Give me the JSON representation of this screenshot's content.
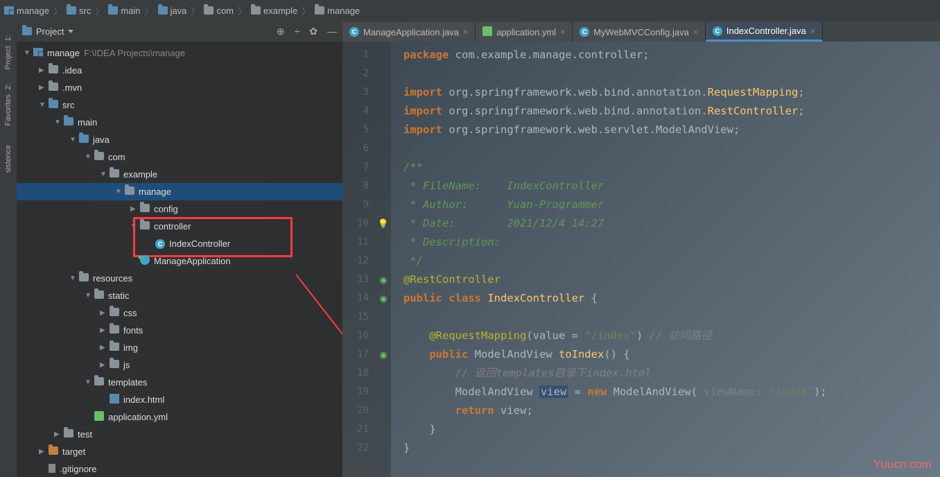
{
  "breadcrumbs": [
    {
      "icon": "module",
      "label": "manage"
    },
    {
      "icon": "folder-blue",
      "label": "src"
    },
    {
      "icon": "folder-blue",
      "label": "main"
    },
    {
      "icon": "folder-blue",
      "label": "java"
    },
    {
      "icon": "folder",
      "label": "com"
    },
    {
      "icon": "folder",
      "label": "example"
    },
    {
      "icon": "folder",
      "label": "manage"
    }
  ],
  "project": {
    "title": "Project",
    "root": {
      "name": "manage",
      "path": "F:\\IDEA Projects\\manage"
    },
    "tree": [
      {
        "indent": 0,
        "arrow": "open",
        "icon": "module",
        "label": "manage",
        "dim": "F:\\IDEA Projects\\manage"
      },
      {
        "indent": 1,
        "arrow": "closed",
        "icon": "folder",
        "label": ".idea"
      },
      {
        "indent": 1,
        "arrow": "closed",
        "icon": "folder",
        "label": ".mvn"
      },
      {
        "indent": 1,
        "arrow": "open",
        "icon": "folder-blue",
        "label": "src"
      },
      {
        "indent": 2,
        "arrow": "open",
        "icon": "folder-blue",
        "label": "main"
      },
      {
        "indent": 3,
        "arrow": "open",
        "icon": "folder-blue",
        "label": "java"
      },
      {
        "indent": 4,
        "arrow": "open",
        "icon": "folder",
        "label": "com"
      },
      {
        "indent": 5,
        "arrow": "open",
        "icon": "folder",
        "label": "example"
      },
      {
        "indent": 6,
        "arrow": "open",
        "icon": "folder",
        "label": "manage",
        "selected": true
      },
      {
        "indent": 7,
        "arrow": "closed",
        "icon": "folder",
        "label": "config"
      },
      {
        "indent": 7,
        "arrow": "open",
        "icon": "folder",
        "label": "controller"
      },
      {
        "indent": 8,
        "arrow": "",
        "icon": "class",
        "label": "IndexController"
      },
      {
        "indent": 7,
        "arrow": "",
        "icon": "app",
        "label": "ManageApplication"
      },
      {
        "indent": 3,
        "arrow": "open",
        "icon": "folder",
        "label": "resources"
      },
      {
        "indent": 4,
        "arrow": "open",
        "icon": "folder",
        "label": "static"
      },
      {
        "indent": 5,
        "arrow": "closed",
        "icon": "folder",
        "label": "css"
      },
      {
        "indent": 5,
        "arrow": "closed",
        "icon": "folder",
        "label": "fonts"
      },
      {
        "indent": 5,
        "arrow": "closed",
        "icon": "folder",
        "label": "img"
      },
      {
        "indent": 5,
        "arrow": "closed",
        "icon": "folder",
        "label": "js"
      },
      {
        "indent": 4,
        "arrow": "open",
        "icon": "folder",
        "label": "templates"
      },
      {
        "indent": 5,
        "arrow": "",
        "icon": "html",
        "label": "index.html"
      },
      {
        "indent": 4,
        "arrow": "",
        "icon": "yml",
        "label": "application.yml"
      },
      {
        "indent": 2,
        "arrow": "closed",
        "icon": "folder",
        "label": "test"
      },
      {
        "indent": 1,
        "arrow": "closed",
        "icon": "folder-orange",
        "label": "target"
      },
      {
        "indent": 1,
        "arrow": "",
        "icon": "file",
        "label": ".gitignore"
      }
    ]
  },
  "tabs": [
    {
      "icon": "class",
      "label": "ManageApplication.java",
      "active": false
    },
    {
      "icon": "yml",
      "label": "application.yml",
      "active": false
    },
    {
      "icon": "class",
      "label": "MyWebMVCConfig.java",
      "active": false
    },
    {
      "icon": "class",
      "label": "IndexController.java",
      "active": true
    }
  ],
  "code": {
    "lines": 22,
    "package": "package com.example.manage.controller;",
    "imports": [
      "import org.springframework.web.bind.annotation.RequestMapping;",
      "import org.springframework.web.bind.annotation.RestController;",
      "import org.springframework.web.servlet.ModelAndView;"
    ],
    "doc": {
      "open": "/**",
      "file": " * FileName:    IndexController",
      "author": " * Author:      Yuan-Programmer",
      "date": " * Date:        2021/12/4 14:27",
      "desc": " * Description:",
      "close": " */"
    },
    "ann": "@RestController",
    "classDecl": "public class IndexController {",
    "mapping": "@RequestMapping(value = \"/index\") // 访问路径",
    "method": "public ModelAndView toIndex() {",
    "cmt1": "// 返回templates目录下index.html",
    "mv": "ModelAndView view = new ModelAndView( viewName: \"index\");",
    "ret": "return view;",
    "lineNumbers": [
      "1",
      "2",
      "3",
      "4",
      "5",
      "6",
      "7",
      "8",
      "9",
      "10",
      "11",
      "12",
      "13",
      "14",
      "15",
      "16",
      "17",
      "18",
      "19",
      "20",
      "21",
      "22"
    ]
  },
  "siderail": [
    {
      "num": "1:",
      "label": "Project"
    },
    {
      "num": "2:",
      "label": "Favorites"
    },
    {
      "num": "",
      "label": "sistence"
    }
  ],
  "watermark": "Yuucn.com"
}
